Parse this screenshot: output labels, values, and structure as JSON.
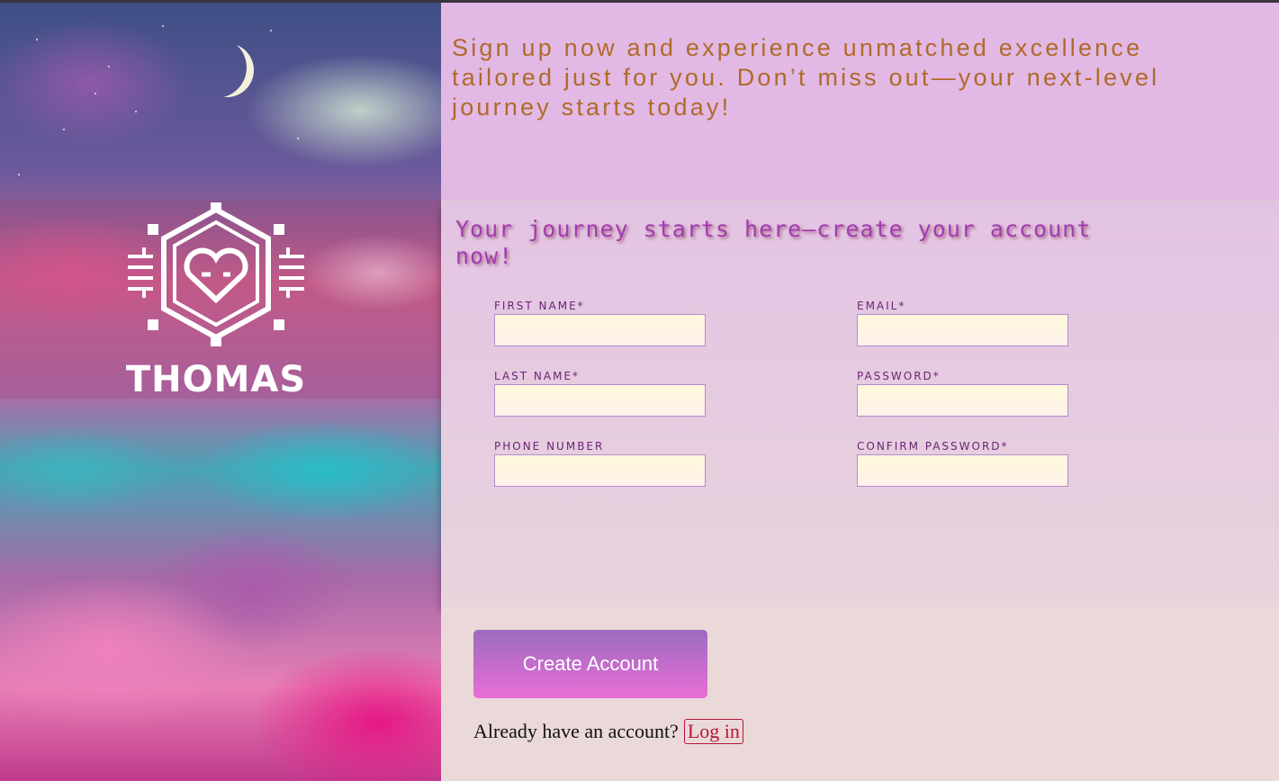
{
  "brand": {
    "name": "THOMAS",
    "logo": "heart-circuit-logo"
  },
  "hero": {
    "text": "Sign up now and experience unmatched excellence tailored just for you. Don’t miss out—your next-level journey starts today!"
  },
  "form": {
    "title": "Your journey starts here—create your account now!",
    "fields": {
      "first_name": {
        "label": "FIRST NAME*",
        "value": ""
      },
      "email": {
        "label": "EMAIL*",
        "value": ""
      },
      "last_name": {
        "label": "LAST NAME*",
        "value": ""
      },
      "password": {
        "label": "PASSWORD*",
        "value": ""
      },
      "phone": {
        "label": "PHONE NUMBER",
        "value": ""
      },
      "confirm_password": {
        "label": "CONFIRM PASSWORD*",
        "value": ""
      }
    }
  },
  "actions": {
    "create_label": "Create Account",
    "login_prompt": "Already have an account?",
    "login_link": "Log in"
  },
  "colors": {
    "hero_bg": "#e1b9e4",
    "hero_text": "#b06a2a",
    "title_text": "#a13db0",
    "label_text": "#6c2474",
    "button_gradient_top": "#9c6bc0",
    "button_gradient_bottom": "#e86ed6",
    "login_link": "#b5163c"
  }
}
